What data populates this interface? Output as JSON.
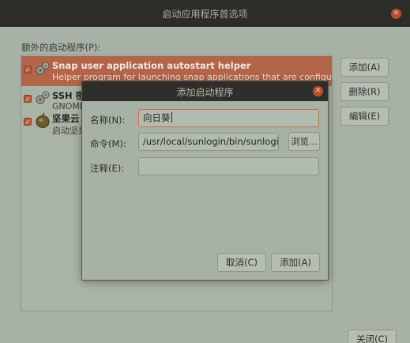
{
  "main_window": {
    "title": "启动应用程序首选项",
    "list_label": "额外的启动程序(P):",
    "programs": [
      {
        "name": "Snap user application autostart helper",
        "description": "Helper program for launching snap applications that are configured t...",
        "checked": true,
        "selected": true,
        "icon": "gears-icon"
      },
      {
        "name": "SSH 密钥",
        "description": "GNOME",
        "checked": true,
        "selected": false,
        "icon": "gears-icon"
      },
      {
        "name": "坚果云",
        "description": "启动坚果云",
        "checked": true,
        "selected": false,
        "icon": "nut-icon"
      }
    ],
    "buttons": {
      "add": "添加(A)",
      "remove": "删除(R)",
      "edit": "编辑(E)",
      "close": "关闭(C)"
    }
  },
  "dialog": {
    "title": "添加启动程序",
    "name_label": "名称(N):",
    "name_value": "向日葵",
    "command_label": "命令(M):",
    "command_value": "/usr/local/sunlogin/bin/sunloginc",
    "browse_label": "浏览...",
    "comment_label": "注释(E):",
    "comment_value": "",
    "cancel_label": "取消(C)",
    "add_label": "添加(A)"
  },
  "colors": {
    "accent": "#b3654a",
    "titlebar": "#2c2d28",
    "close": "#b9502e"
  }
}
